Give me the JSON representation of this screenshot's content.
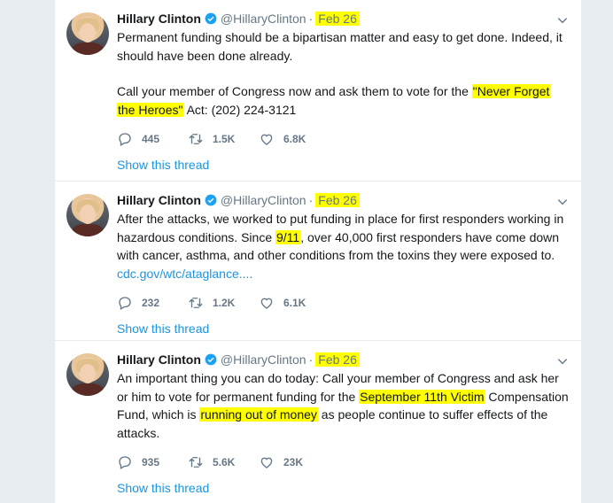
{
  "tweets": [
    {
      "name": "Hillary Clinton",
      "handle": "@HillaryClinton",
      "dot": "·",
      "date": "Feb 26",
      "para1": "Permanent funding should be a bipartisan matter and easy to get done. Indeed, it should have been done already.",
      "para2_a": "Call your member of Congress now and ask them to vote for the ",
      "para2_hl1": "\"Never Forget",
      "para2_hl2": "the Heroes\"",
      "para2_b": " Act: (202) 224-3121",
      "replies": "445",
      "retweets": "1.5K",
      "likes": "6.8K",
      "show_thread": "Show this thread"
    },
    {
      "name": "Hillary Clinton",
      "handle": "@HillaryClinton",
      "dot": "·",
      "date": "Feb 26",
      "text_a": "After the attacks, we worked to put funding in place for first responders working in hazardous conditions. Since ",
      "text_hl": "9/11",
      "text_b": ", over 40,000 first responders have come down with cancer, asthma, and other conditions from the toxins they were exposed to.",
      "link": "cdc.gov/wtc/ataglance....",
      "replies": "232",
      "retweets": "1.2K",
      "likes": "6.1K",
      "show_thread": "Show this thread"
    },
    {
      "name": "Hillary Clinton",
      "handle": "@HillaryClinton",
      "dot": "·",
      "date": "Feb 26",
      "text_a": "An important thing you can do today: Call your member of Congress and ask her or him to vote for permanent funding for the ",
      "text_hl1": "September 11th Victim",
      "text_b": " Compensation Fund, which is ",
      "text_hl2": "running out of money",
      "text_c": " as people continue to suffer effects of the attacks.",
      "replies": "935",
      "retweets": "5.6K",
      "likes": "23K",
      "show_thread": "Show this thread"
    }
  ],
  "colors": {
    "highlight": "#ffff00",
    "link": "#1b95e0",
    "muted": "#657786",
    "verified": "#1da1f2"
  }
}
